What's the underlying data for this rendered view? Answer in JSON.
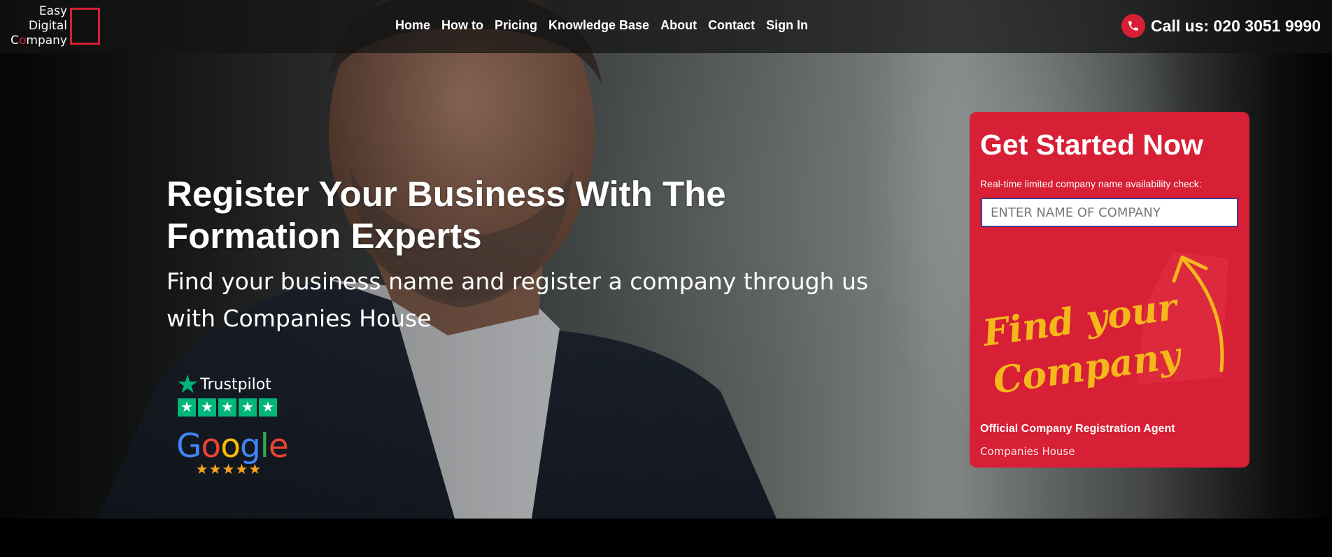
{
  "colors": {
    "brand_red": "#d71f35",
    "nav_bg": "#141414",
    "trustpilot_green": "#00b67a",
    "script_yellow": "#f5b81a"
  },
  "logo": {
    "line1": "Easy",
    "line2": "Digital",
    "line3_start": "C",
    "line3_accent": "o",
    "line3_end": "mpany"
  },
  "nav": {
    "items": [
      "Home",
      "How to",
      "Pricing",
      "Knowledge Base",
      "About",
      "Contact",
      "Sign In"
    ]
  },
  "call": {
    "icon": "phone-icon",
    "label": "Call us: 020 3051 9990"
  },
  "hero": {
    "headline": "Register Your Business With The Formation Experts",
    "subline": "Find your business name and register a company through us with Companies House"
  },
  "badges": {
    "trustpilot": {
      "name": "Trustpilot",
      "stars": 5
    },
    "google": {
      "letters": [
        "G",
        "o",
        "o",
        "g",
        "l",
        "e"
      ],
      "stars": 5
    }
  },
  "form": {
    "title": "Get Started Now",
    "label": "Real-time limited company name availability check:",
    "placeholder": "ENTER NAME OF COMPANY",
    "script_line1": "Find your",
    "script_line2": "Company",
    "agent": "Official Company Registration Agent",
    "authority": "Companies House"
  }
}
